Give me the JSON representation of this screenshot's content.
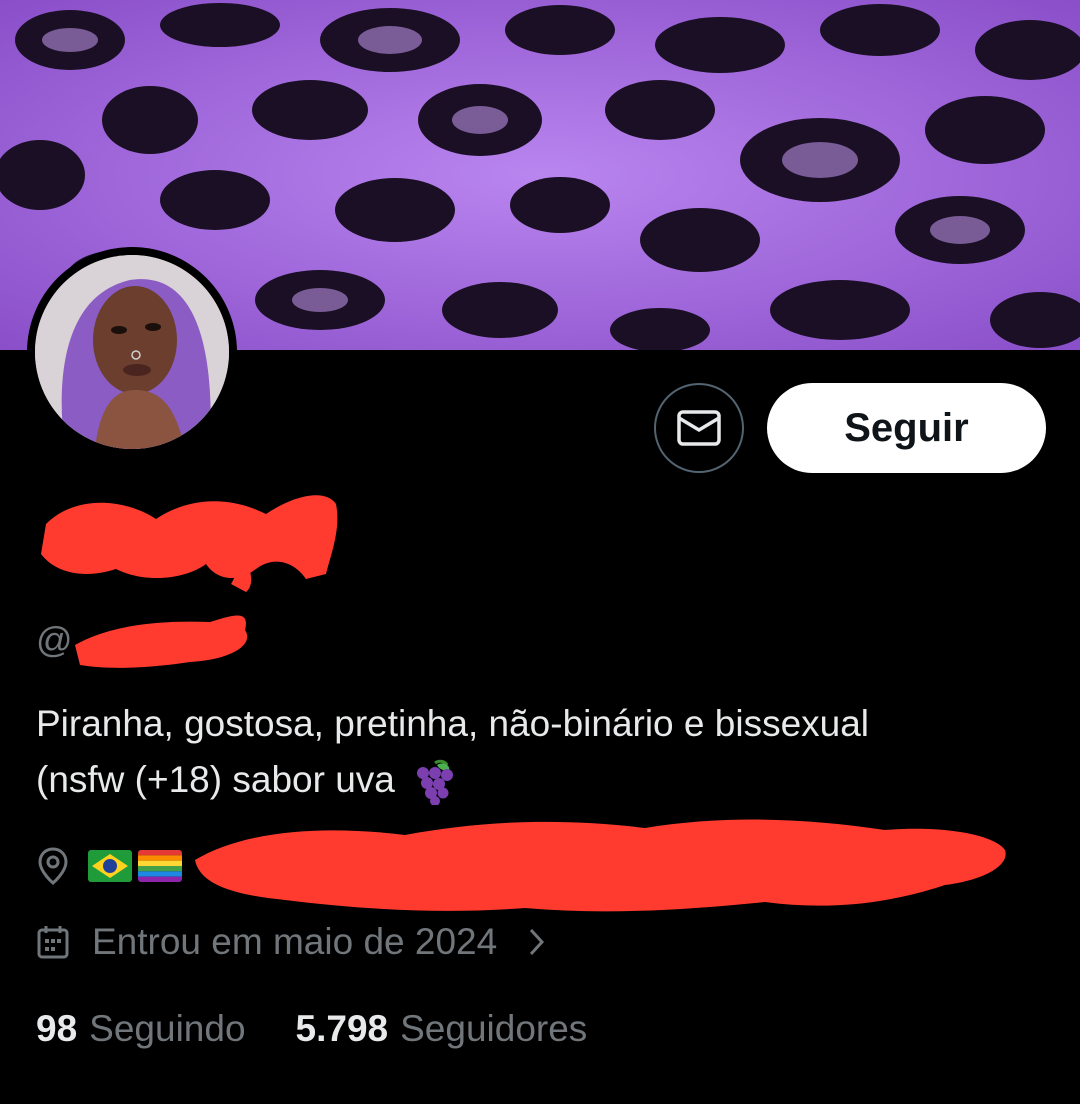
{
  "profile": {
    "handle_prefix": "@",
    "bio_line_1": "Piranha, gostosa, pretinha, não-binário e bissexual",
    "bio_line_2": "(nsfw (+18) sabor uva",
    "bio_emoji": "grapes-emoji",
    "location_flags": [
      "brazil-flag",
      "rainbow-pride-flag"
    ],
    "joined": "Entrou em maio de 2024"
  },
  "actions": {
    "message_icon": "envelope-icon",
    "follow_label": "Seguir"
  },
  "stats": {
    "following_count": "98",
    "following_label": "Seguindo",
    "followers_count": "5.798",
    "followers_label": "Seguidores"
  },
  "colors": {
    "background": "#000000",
    "banner_purple": "#a86ee0",
    "text_primary": "#e7e9ea",
    "text_secondary": "#71767b",
    "redaction": "#ff3b30",
    "follow_button_bg": "#ffffff"
  }
}
